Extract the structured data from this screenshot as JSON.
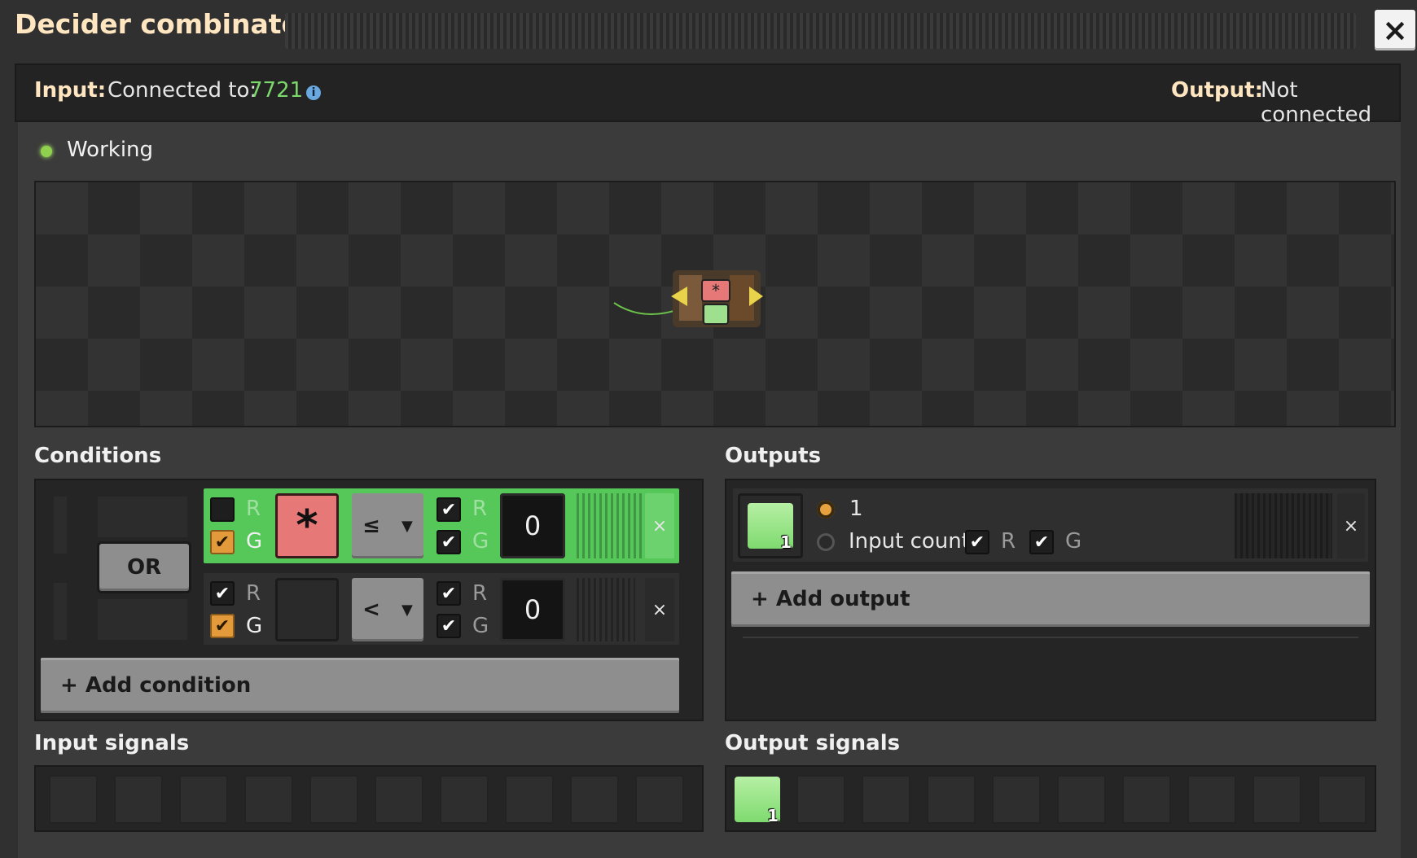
{
  "window": {
    "title": "Decider combinator",
    "close_icon": "×"
  },
  "connection": {
    "input_label": "Input:",
    "input_connected_label": "Connected to:",
    "input_network_id": "7721",
    "output_label": "Output:",
    "output_status": "Not connected"
  },
  "status": {
    "text": "Working"
  },
  "conditions": {
    "title": "Conditions",
    "or_label": "OR",
    "rows": [
      {
        "r_label": "R",
        "g_label": "G",
        "operator": "≤",
        "value": "0",
        "left_signal": "*",
        "right_r_label": "R",
        "right_g_label": "G",
        "remove": "×"
      },
      {
        "r_label": "R",
        "g_label": "G",
        "operator": "<",
        "value": "0",
        "left_signal": "",
        "right_r_label": "R",
        "right_g_label": "G",
        "remove": "×"
      }
    ],
    "add_label": "+ Add condition"
  },
  "outputs": {
    "title": "Outputs",
    "row": {
      "badge": "1",
      "option_constant": "1",
      "option_input_count": "Input count",
      "r_label": "R",
      "g_label": "G",
      "remove": "×"
    },
    "add_label": "+ Add output"
  },
  "input_signals": {
    "title": "Input signals"
  },
  "output_signals": {
    "title": "Output signals",
    "first_badge": "1"
  },
  "colors": {
    "accent_green": "#56c85a",
    "network_id_green": "#7bd86b",
    "title_cream": "#ffe6c0"
  }
}
